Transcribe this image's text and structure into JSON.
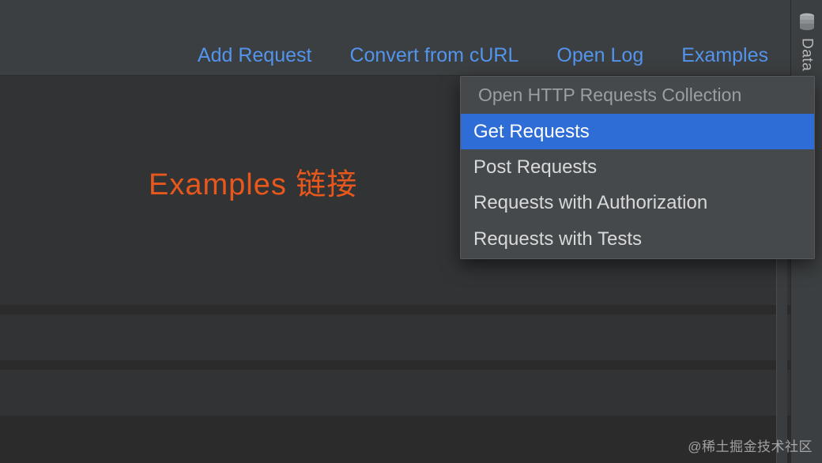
{
  "toolbar": {
    "add_request": "Add Request",
    "convert_curl": "Convert from cURL",
    "open_log": "Open Log",
    "examples": "Examples"
  },
  "right_panel": {
    "tool_label": "Data",
    "icon": "database-icon"
  },
  "annotation": "Examples 链接",
  "popup": {
    "title": "Open HTTP Requests Collection",
    "items": [
      {
        "label": "Get Requests",
        "selected": true
      },
      {
        "label": "Post Requests",
        "selected": false
      },
      {
        "label": "Requests with Authorization",
        "selected": false
      },
      {
        "label": "Requests with Tests",
        "selected": false
      }
    ]
  },
  "watermark": "@稀土掘金技术社区"
}
